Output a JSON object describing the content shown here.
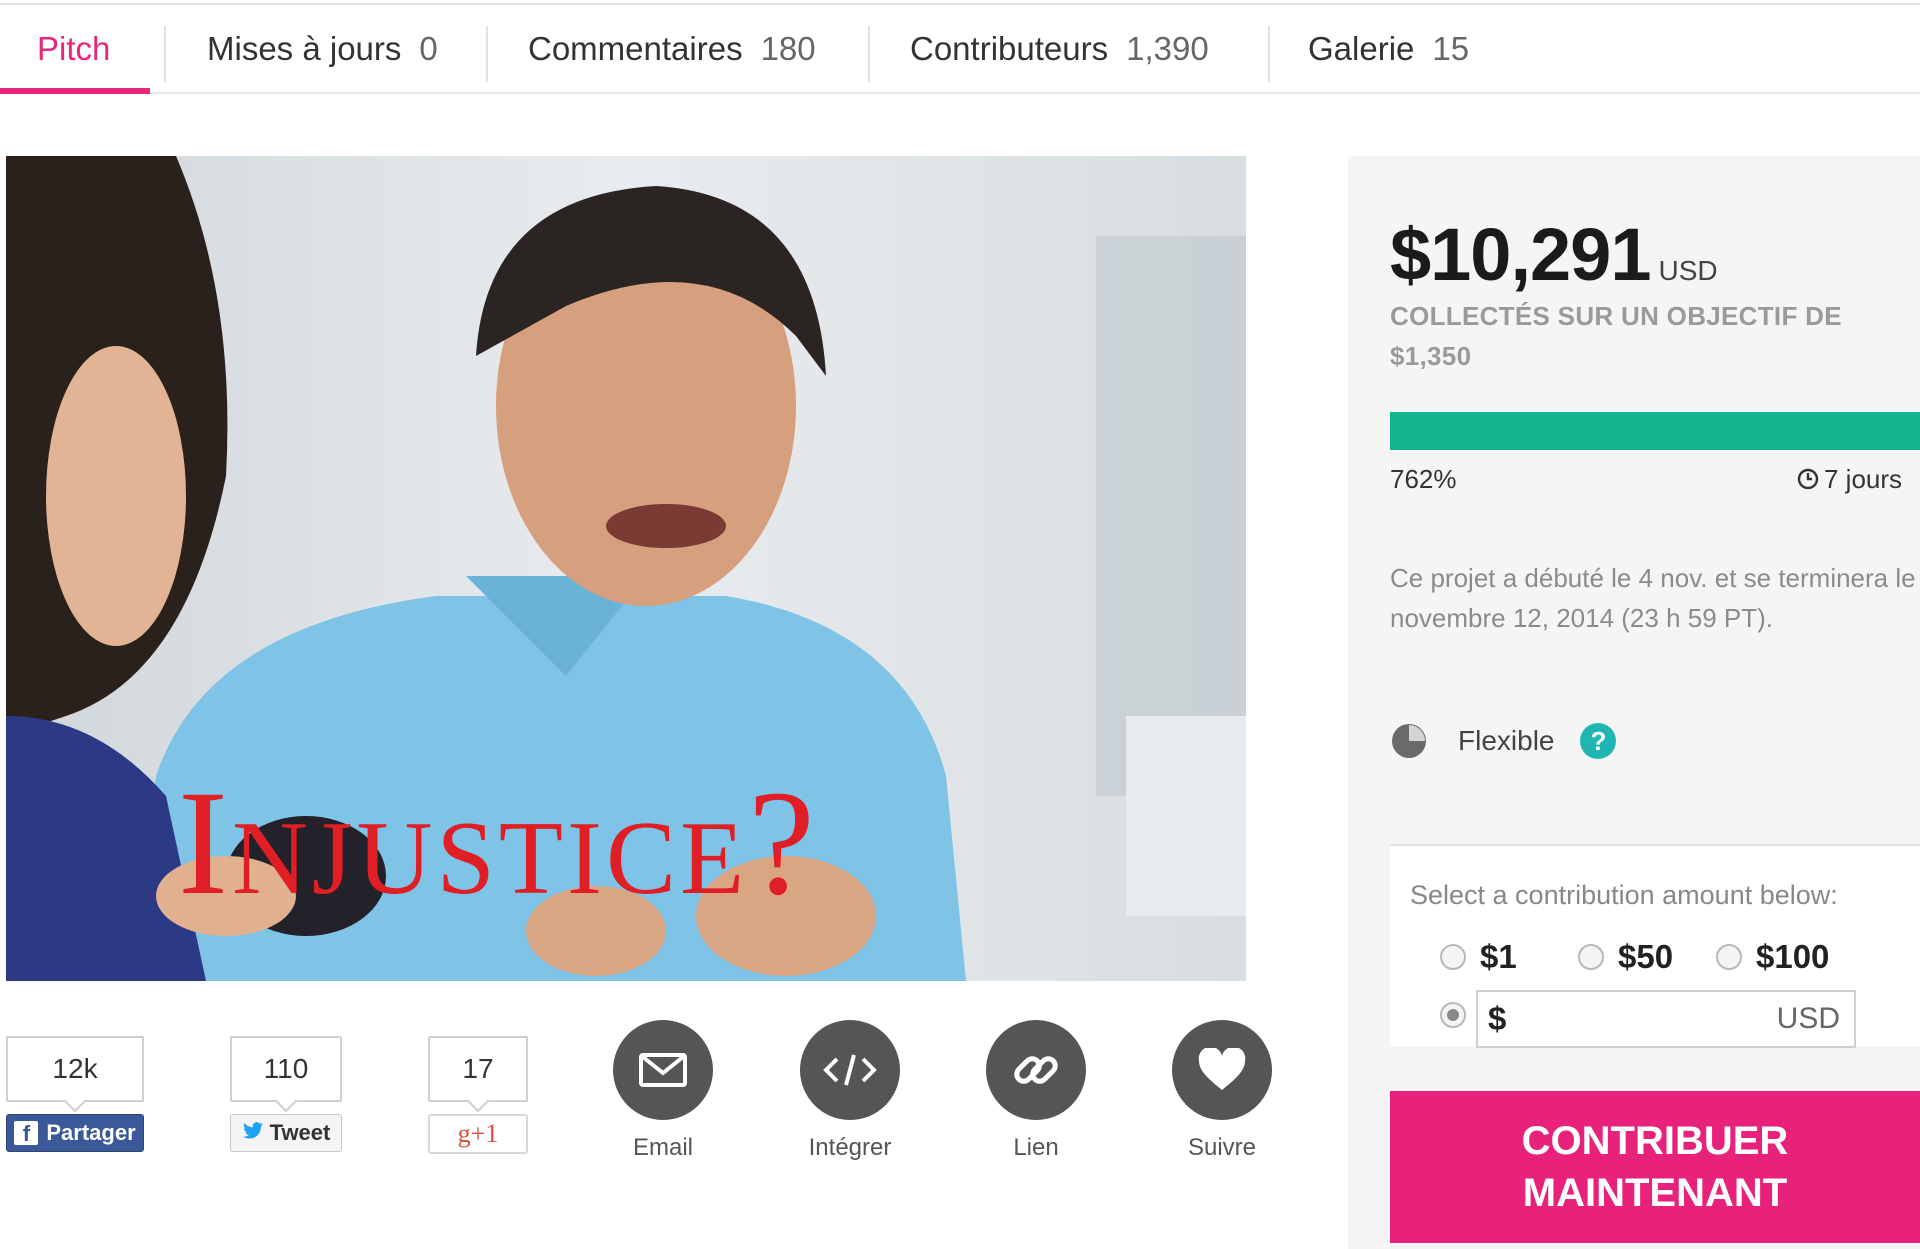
{
  "tabs": [
    {
      "label": "Pitch",
      "count": "",
      "active": true
    },
    {
      "label": "Mises à jours",
      "count": "0"
    },
    {
      "label": "Commentaires",
      "count": "180"
    },
    {
      "label": "Contributeurs",
      "count": "1,390"
    },
    {
      "label": "Galerie",
      "count": "15"
    }
  ],
  "hero": {
    "overlay_text": "Injustice?"
  },
  "share": {
    "facebook": {
      "count": "12k",
      "label": "Partager",
      "icon": "facebook-icon"
    },
    "twitter": {
      "count": "110",
      "label": "Tweet",
      "icon": "twitter-bird-icon"
    },
    "google": {
      "count": "17",
      "label": "g+1",
      "icon": "google-plus-icon"
    }
  },
  "actions": [
    {
      "label": "Email",
      "icon": "envelope-icon"
    },
    {
      "label": "Intégrer",
      "icon": "code-icon"
    },
    {
      "label": "Lien",
      "icon": "link-icon"
    },
    {
      "label": "Suivre",
      "icon": "heart-icon"
    }
  ],
  "campaign": {
    "amount": "$10,291",
    "currency": "USD",
    "goal_text": "COLLECTÉS SUR UN OBJECTIF DE $1,350",
    "percent": "762%",
    "progress_fraction": 1.0,
    "days_left": "7 jours",
    "note": "Ce projet a débuté le 4 nov. et se terminera le novembre 12, 2014 (23 h 59 PT).",
    "funding_type": "Flexible",
    "help_label": "?"
  },
  "contribution": {
    "prompt": "Select a contribution amount below:",
    "options": [
      "$1",
      "$50",
      "$100"
    ],
    "custom_prefix": "$",
    "custom_currency": "USD",
    "cta_line1": "CONTRIBUER",
    "cta_line2": "MAINTENANT"
  },
  "colors": {
    "accent": "#e8227a",
    "progress": "#13b58f",
    "help": "#1fb5b0"
  }
}
